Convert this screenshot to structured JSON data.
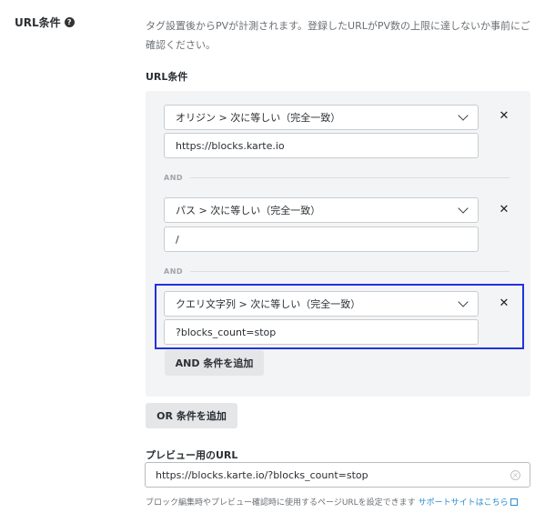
{
  "left_label": {
    "text": "URL条件",
    "help_icon": "?"
  },
  "description": "タグ設置後からPVが計測されます。登録したURLがPV数の上限に達しないか事前にご確認ください。",
  "url_conditions": {
    "label": "URL条件",
    "and_label": "AND",
    "rows": [
      {
        "select": "オリジン > 次に等しい（完全一致）",
        "value": "https://blocks.karte.io"
      },
      {
        "select": "パス > 次に等しい（完全一致）",
        "value": "/"
      },
      {
        "select": "クエリ文字列 > 次に等しい（完全一致）",
        "value": "?blocks_count=stop"
      }
    ],
    "remove_icon": "✕",
    "add_and_button": "AND 条件を追加",
    "add_or_button": "OR 条件を追加"
  },
  "preview": {
    "label": "プレビュー用のURL",
    "value": "https://blocks.karte.io/?blocks_count=stop",
    "clear_icon": "×",
    "help_text": "ブロック編集時やプレビュー確認時に使用するページURLを設定できます",
    "help_link": "サポートサイトはこちら"
  },
  "colors": {
    "highlight_border": "#2233dd",
    "link": "#2a8bd0",
    "panel_bg": "#f3f4f5"
  }
}
